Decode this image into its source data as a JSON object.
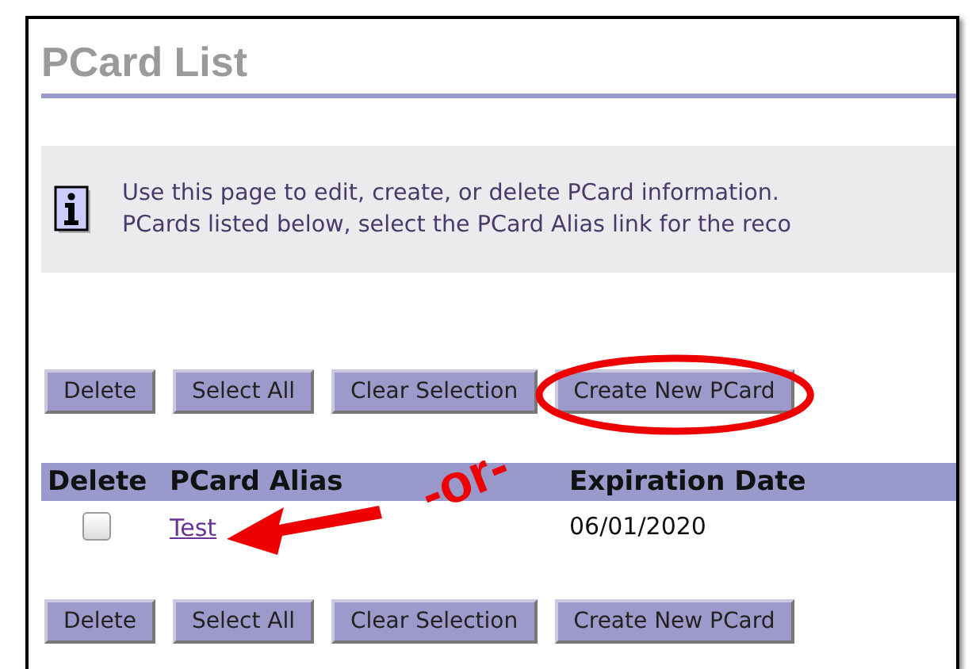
{
  "page": {
    "title": "PCard List"
  },
  "info": {
    "lines": [
      "Use this page to edit, create, or delete PCard information.",
      "PCards listed below, select the PCard Alias link for the reco"
    ]
  },
  "top_buttons": [
    {
      "label": "Delete",
      "highlighted": false
    },
    {
      "label": "Select All",
      "highlighted": false
    },
    {
      "label": "Clear Selection",
      "highlighted": false
    },
    {
      "label": "Create New PCard",
      "highlighted": true
    }
  ],
  "table": {
    "columns": [
      "Delete",
      "PCard Alias",
      "Expiration Date"
    ],
    "rows": [
      {
        "checked": false,
        "alias": "Test",
        "expiration": "06/01/2020",
        "pointed": true
      }
    ]
  },
  "bottom_buttons": [
    {
      "label": "Delete"
    },
    {
      "label": "Select All"
    },
    {
      "label": "Clear Selection"
    },
    {
      "label": "Create New PCard"
    }
  ],
  "annotation": {
    "text": "-or-"
  }
}
